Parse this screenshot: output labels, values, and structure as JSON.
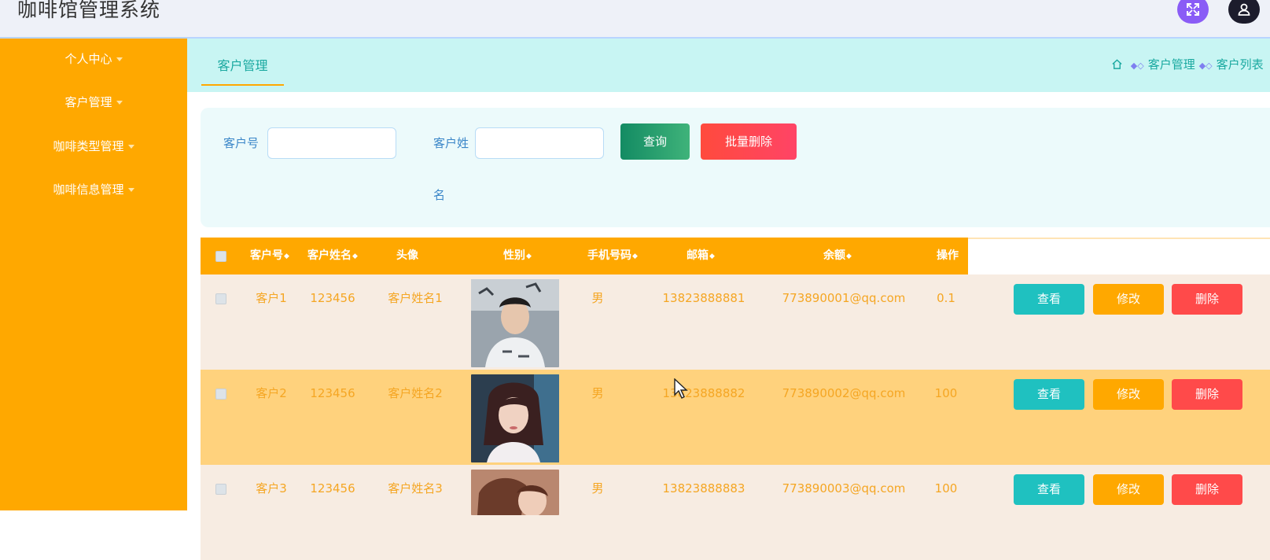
{
  "app": {
    "title": "咖啡馆管理系统"
  },
  "header": {
    "fullscreen_icon": "expand-icon",
    "user_icon": "user-icon"
  },
  "sidebar": {
    "items": [
      {
        "label": "个人中心"
      },
      {
        "label": "客户管理"
      },
      {
        "label": "咖啡类型管理"
      },
      {
        "label": "咖啡信息管理"
      }
    ]
  },
  "tabs": {
    "active": "客户管理"
  },
  "breadcrumb": {
    "items": [
      "客户管理",
      "客户列表"
    ]
  },
  "search": {
    "field1_label": "客户号",
    "field1_value": "",
    "field2_label_a": "客户姓",
    "field2_label_b": "名",
    "field2_value": "",
    "query_button": "查询",
    "batch_delete_button": "批量删除"
  },
  "table": {
    "headers": {
      "customer_no": "客户号",
      "password": "客户姓名",
      "avatar": "头像",
      "gender": "性别",
      "phone": "手机号码",
      "email": "邮箱",
      "balance": "余额",
      "actions": "操作"
    },
    "action_labels": {
      "view": "查看",
      "edit": "修改",
      "delete": "删除"
    },
    "rows": [
      {
        "customer_no": "客户1",
        "password": "123456",
        "name": "客户姓名1",
        "gender": "男",
        "phone": "13823888881",
        "email": "773890001@qq.com",
        "balance": "0.1"
      },
      {
        "customer_no": "客户2",
        "password": "123456",
        "name": "客户姓名2",
        "gender": "男",
        "phone": "13823888882",
        "email": "773890002@qq.com",
        "balance": "100"
      },
      {
        "customer_no": "客户3",
        "password": "123456",
        "name": "客户姓名3",
        "gender": "男",
        "phone": "13823888883",
        "email": "773890003@qq.com",
        "balance": "100"
      }
    ]
  },
  "colors": {
    "sidebar": "#ffa800",
    "tabs_bg": "#c8f5f3",
    "accent": "#1aa9a0",
    "row_highlight": "#ffd27d"
  }
}
